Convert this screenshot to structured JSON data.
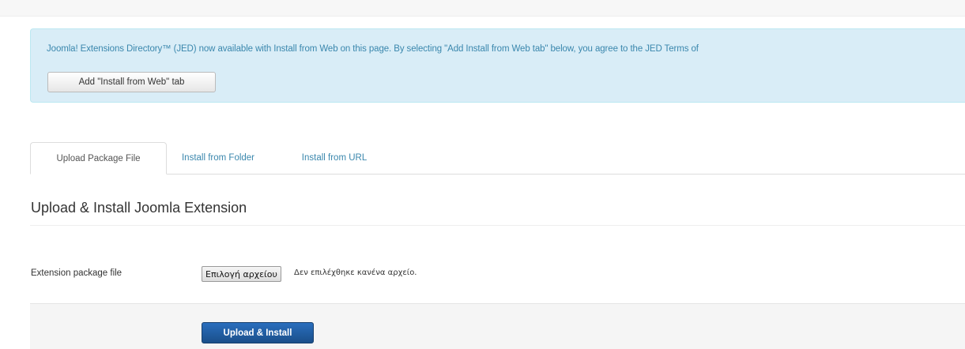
{
  "jed_alert": {
    "text_1": "Joomla! Extensions Directory™ (JED) now available with ",
    "link_install_from_web": "Install from Web",
    "text_2": " on this page.  By selecting \"Add Install from Web tab\" below, you agree to the JED ",
    "link_terms": "Terms of",
    "add_tab_button": "Add \"Install from Web\" tab"
  },
  "tabs": [
    {
      "label": "Upload Package File",
      "active": true
    },
    {
      "label": "Install from Folder",
      "active": false
    },
    {
      "label": "Install from URL",
      "active": false
    }
  ],
  "section": {
    "title": "Upload & Install Joomla Extension"
  },
  "form": {
    "package_label": "Extension package file",
    "file_button": "Επιλογή αρχείου",
    "file_status": "Δεν επιλέχθηκε κανένα αρχείο."
  },
  "actions": {
    "upload_button": "Upload & Install"
  },
  "colors": {
    "alert_bg": "#d9edf7",
    "alert_text": "#3a87ad",
    "primary_button": "#1f5ea4"
  }
}
